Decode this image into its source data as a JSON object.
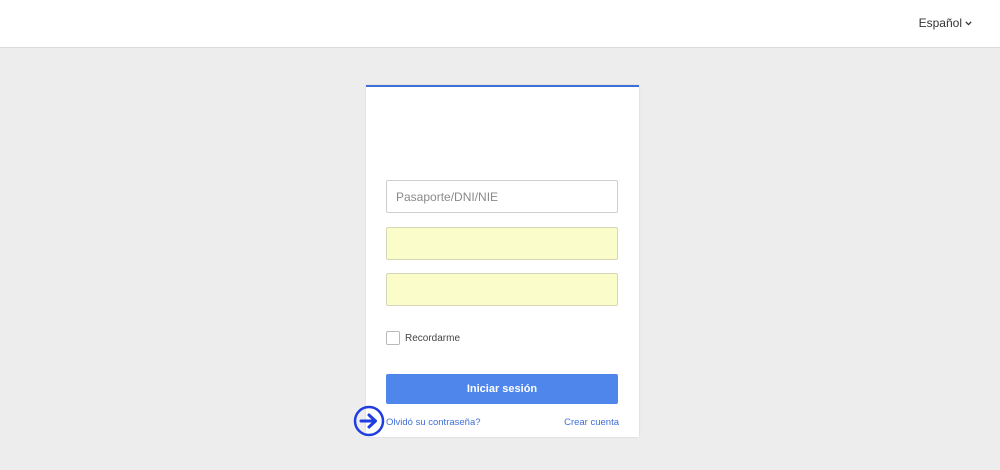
{
  "header": {
    "language_label": "Español",
    "language_icon": "chevron-down-icon"
  },
  "login": {
    "document_placeholder": "Pasaporte/DNI/NIE",
    "document_value": "",
    "field2_value": "",
    "field3_value": "",
    "remember_label": "Recordarme",
    "submit_label": "Iniciar sesión",
    "forgot_label": "Olvidó su contraseña?",
    "create_label": "Crear cuenta"
  },
  "colors": {
    "accent": "#3f6fd6",
    "button": "#4f86ec",
    "autofill": "#fafdc9",
    "background": "#ededed"
  },
  "annotation": {
    "icon": "arrow-right-circle-icon"
  }
}
